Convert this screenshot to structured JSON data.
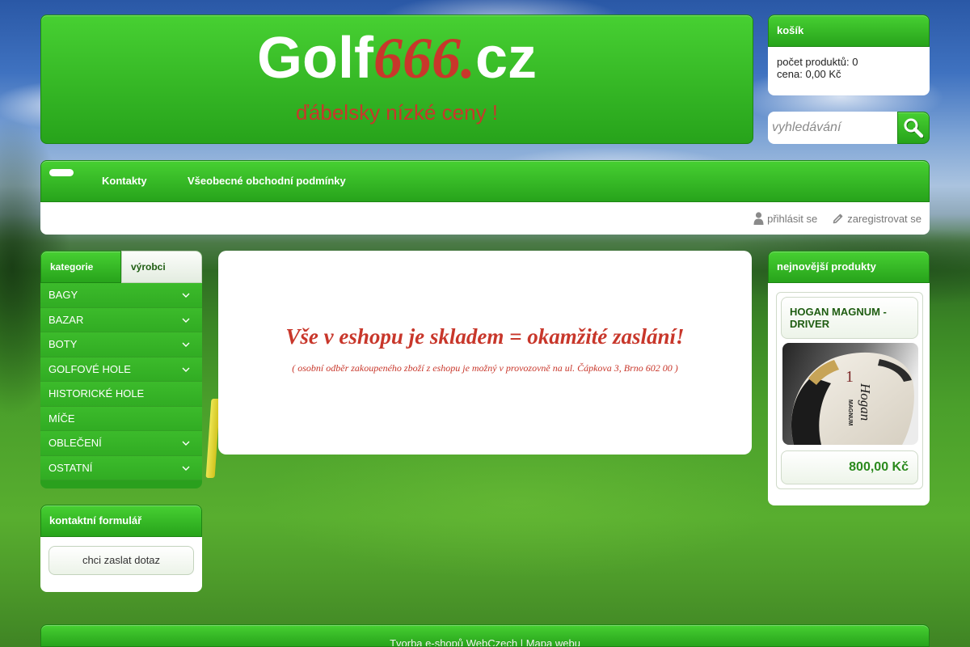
{
  "header": {
    "logo": {
      "golf": "Golf",
      "number": "666.",
      "tld": "cz"
    },
    "tagline": "ďábelsky nízké ceny !"
  },
  "cart": {
    "title": "košík",
    "count_label": "počet produktů:",
    "count": "0",
    "price_label": "cena:",
    "price": "0,00 Kč"
  },
  "search": {
    "placeholder": "vyhledávání",
    "value": ""
  },
  "nav": {
    "items": [
      {
        "label": "Kontakty"
      },
      {
        "label": "Všeobecné obchodní podmínky"
      }
    ]
  },
  "user": {
    "login": "přihlásit se",
    "register": "zaregistrovat se"
  },
  "sidebar": {
    "tabs": [
      {
        "label": "kategorie",
        "active": true
      },
      {
        "label": "výrobci",
        "active": false
      }
    ],
    "categories": [
      {
        "label": "BAGY",
        "has_submenu": true
      },
      {
        "label": "BAZAR",
        "has_submenu": true
      },
      {
        "label": "BOTY",
        "has_submenu": true
      },
      {
        "label": "GOLFOVÉ HOLE",
        "has_submenu": true
      },
      {
        "label": "HISTORICKÉ HOLE",
        "has_submenu": false
      },
      {
        "label": "MÍČE",
        "has_submenu": false
      },
      {
        "label": "OBLEČENÍ",
        "has_submenu": true
      },
      {
        "label": "OSTATNÍ",
        "has_submenu": true
      }
    ]
  },
  "contact_form": {
    "title": "kontaktní formulář",
    "button": "chci zaslat dotaz"
  },
  "main": {
    "headline": "Vše v eshopu je skladem = okamžité zaslání!",
    "note": "( osobní odběr zakoupeného zboží z eshopu je možný v provozovně na ul. Čápkova 3, Brno 602 00 )"
  },
  "newest": {
    "title": "nejnovější produkty",
    "products": [
      {
        "name": "HOGAN MAGNUM - DRIVER",
        "price": "800,00 Kč",
        "image_lettering": {
          "number": "1",
          "brand": "Hogan",
          "model": "MAGNUM"
        }
      }
    ]
  },
  "footer": {
    "links": [
      {
        "label": "Tvorba e-shopů WebCzech"
      },
      {
        "label": "Mapa webu"
      }
    ],
    "separator": "|"
  },
  "icons": {
    "home": "home-icon",
    "search": "search-icon",
    "login": "user-icon",
    "register": "pencil-icon",
    "category_expand": "chevron-down-icon"
  },
  "colors": {
    "green_top": "#47d032",
    "green_bottom": "#27a31b",
    "green_border": "#1d8513",
    "accent_red": "#c8372b",
    "title_green": "#1f5d12",
    "price_green": "#2b8a1d"
  }
}
